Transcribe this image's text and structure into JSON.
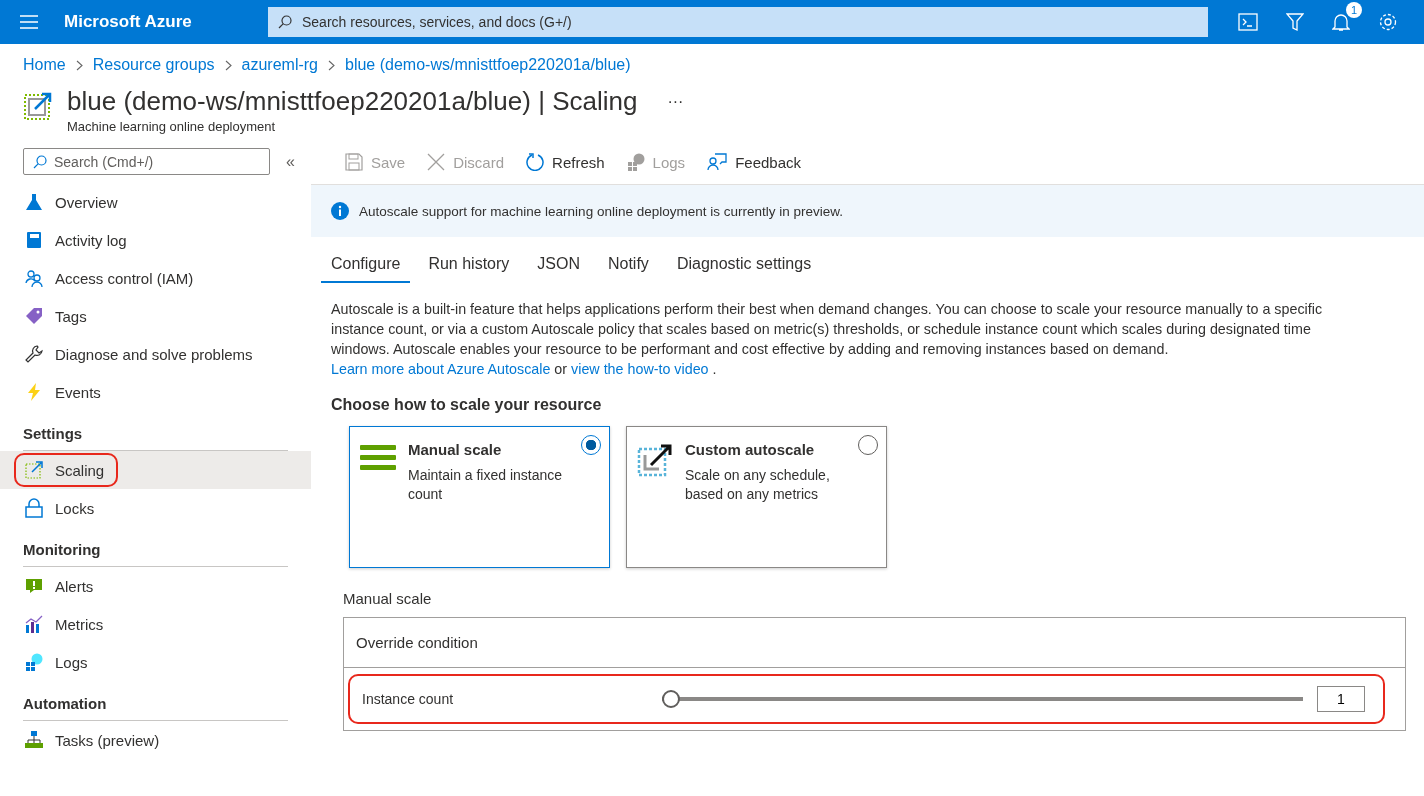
{
  "topbar": {
    "brand": "Microsoft Azure",
    "search_placeholder": "Search resources, services, and docs (G+/)",
    "notification_count": "1"
  },
  "breadcrumb": [
    "Home",
    "Resource groups",
    "azureml-rg",
    "blue (demo-ws/mnisttfoep220201a/blue)"
  ],
  "header": {
    "title": "blue (demo-ws/mnisttfoep220201a/blue) | Scaling",
    "more": "···",
    "subtitle": "Machine learning online deployment"
  },
  "sidebar": {
    "search_placeholder": "Search (Cmd+/)",
    "collapse": "«",
    "sections": [
      {
        "items": [
          {
            "kind": "overview",
            "label": "Overview",
            "selected": false,
            "annotated": false
          },
          {
            "kind": "activity",
            "label": "Activity log",
            "selected": false,
            "annotated": false
          },
          {
            "kind": "access",
            "label": "Access control (IAM)",
            "selected": false,
            "annotated": false
          },
          {
            "kind": "tags",
            "label": "Tags",
            "selected": false,
            "annotated": false
          },
          {
            "kind": "diagnose",
            "label": "Diagnose and solve problems",
            "selected": false,
            "annotated": false
          },
          {
            "kind": "events",
            "label": "Events",
            "selected": false,
            "annotated": false
          }
        ]
      },
      {
        "heading": "Settings",
        "items": [
          {
            "kind": "scaling",
            "label": "Scaling",
            "selected": true,
            "annotated": true
          },
          {
            "kind": "locks",
            "label": "Locks",
            "selected": false,
            "annotated": false
          }
        ]
      },
      {
        "heading": "Monitoring",
        "items": [
          {
            "kind": "alerts",
            "label": "Alerts",
            "selected": false,
            "annotated": false
          },
          {
            "kind": "metrics",
            "label": "Metrics",
            "selected": false,
            "annotated": false
          },
          {
            "kind": "logs",
            "label": "Logs",
            "selected": false,
            "annotated": false
          }
        ]
      },
      {
        "heading": "Automation",
        "items": [
          {
            "kind": "tasks",
            "label": "Tasks (preview)",
            "selected": false,
            "annotated": false
          }
        ]
      }
    ]
  },
  "toolbar": [
    {
      "kind": "save",
      "label": "Save",
      "disabled": true
    },
    {
      "kind": "discard",
      "label": "Discard",
      "disabled": true
    },
    {
      "kind": "refresh",
      "label": "Refresh",
      "disabled": false
    },
    {
      "kind": "logs",
      "label": "Logs",
      "disabled": true
    },
    {
      "kind": "feedback",
      "label": "Feedback",
      "disabled": false
    }
  ],
  "info_banner": "Autoscale support for machine learning online deployment is currently in preview.",
  "tabs": [
    {
      "label": "Configure",
      "selected": true
    },
    {
      "label": "Run history",
      "selected": false
    },
    {
      "label": "JSON",
      "selected": false
    },
    {
      "label": "Notify",
      "selected": false
    },
    {
      "label": "Diagnostic settings",
      "selected": false
    }
  ],
  "description": [
    {
      "kind": "text",
      "text": "Autoscale is a built-in feature that helps applications perform their best when demand changes. You can choose to scale your resource manually to a specific instance count, or via a custom Autoscale policy that scales based on metric(s) thresholds, or schedule instance count which scales during designated time windows. Autoscale enables your resource to be performant and cost effective by adding and removing instances based on demand."
    },
    {
      "kind": "link",
      "text": "Learn more about Azure Autoscale"
    },
    {
      "kind": "text",
      "text": "or"
    },
    {
      "kind": "link",
      "text": "view the how-to video"
    },
    {
      "kind": "text",
      "text": "."
    }
  ],
  "choose_heading": "Choose how to scale your resource",
  "scale_options": [
    {
      "kind": "manual",
      "title": "Manual scale",
      "description": "Maintain a fixed instance count",
      "selected": true
    },
    {
      "kind": "custom",
      "title": "Custom autoscale",
      "description": "Scale on any schedule, based on any metrics",
      "selected": false
    }
  ],
  "manual_scale": {
    "label": "Manual scale",
    "condition": "Override condition",
    "instance_count": {
      "label": "Instance count",
      "level": 0,
      "value": "1",
      "annotated": true
    }
  }
}
